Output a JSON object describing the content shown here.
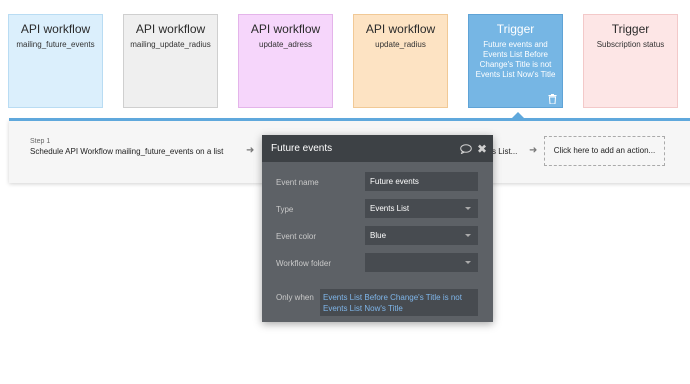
{
  "cards": [
    {
      "title": "API workflow",
      "subtitle": "mailing_future_events",
      "bg": "#dbeffc",
      "border": "#b9dcf3"
    },
    {
      "title": "API workflow",
      "subtitle": "mailing_update_radius",
      "bg": "#efefef",
      "border": "#cfcfcf"
    },
    {
      "title": "API workflow",
      "subtitle": "update_adress",
      "bg": "#f6d6fb",
      "border": "#e4b4ea"
    },
    {
      "title": "API workflow",
      "subtitle": "update_radius",
      "bg": "#fde3c3",
      "border": "#f1c996"
    },
    {
      "title": "Trigger",
      "subtitle": "Future events and Events List Before Change's Title is not Events List Now's Title",
      "bg": "#76b6e4",
      "border": "#5fa3d6"
    },
    {
      "title": "Trigger",
      "subtitle": "Subscription status",
      "bg": "#fde6e6",
      "border": "#f3c9c9"
    }
  ],
  "step": {
    "label": "Step 1",
    "title": "Schedule API Workflow mailing_future_events on a list",
    "fragment": "s List...",
    "add_action": "Click here to add an action..."
  },
  "panel": {
    "title": "Future events",
    "fields": {
      "event_name": {
        "label": "Event name",
        "value": "Future events"
      },
      "type": {
        "label": "Type",
        "value": "Events List"
      },
      "event_color": {
        "label": "Event color",
        "value": "Blue"
      },
      "workflow_folder": {
        "label": "Workflow folder",
        "value": ""
      }
    },
    "only_when": {
      "label": "Only when",
      "value": "Events List Before Change's Title is not Events List Now's Title"
    }
  },
  "icons": {
    "comment": "comment-icon",
    "close": "close-icon",
    "trash": "trash-icon",
    "arrow": "arrow-right-icon"
  },
  "colors": {
    "accent": "#5fa8dc",
    "panel_bg": "#5d6166",
    "panel_header": "#3d4145",
    "link": "#7fb6ea"
  }
}
